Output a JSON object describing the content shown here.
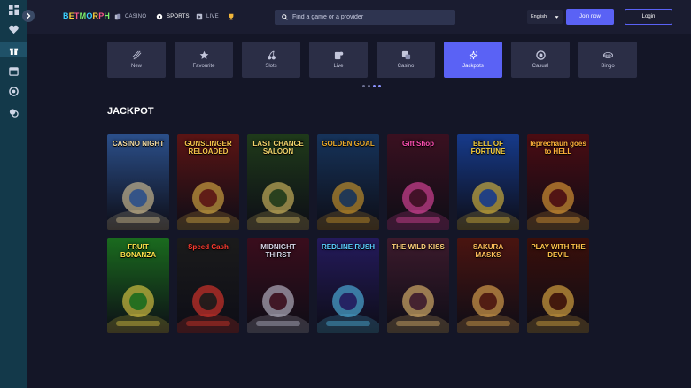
{
  "sidebar": {
    "icons": [
      "grid-icon",
      "heart-icon",
      "gift-icon",
      "calendar-icon",
      "chip-icon",
      "coins-icon"
    ]
  },
  "header": {
    "logo": "BETMORPH",
    "nav": [
      {
        "label": "CASINO",
        "icon": "cards-icon"
      },
      {
        "label": "SPORTS",
        "icon": "ball-icon"
      },
      {
        "label": "LIVE",
        "icon": "live-icon"
      }
    ],
    "search_placeholder": "Find a game or a provider",
    "language": "English",
    "join_label": "Join now",
    "login_label": "Login"
  },
  "categories": [
    {
      "label": "New",
      "icon": "sparkle-icon"
    },
    {
      "label": "Favourite",
      "icon": "star-icon"
    },
    {
      "label": "Slots",
      "icon": "cherry-icon"
    },
    {
      "label": "Live",
      "icon": "dealer-icon"
    },
    {
      "label": "Casino",
      "icon": "dice-icon"
    },
    {
      "label": "Jackpots",
      "icon": "sparkles-icon"
    },
    {
      "label": "Casual",
      "icon": "chip-icon"
    },
    {
      "label": "Bingo",
      "icon": "bingo-icon"
    }
  ],
  "active_category": "Jackpots",
  "section_title": "JACKPOT",
  "games": [
    {
      "title": "CASINO NIGHT",
      "bg": "#2b4f8a",
      "accent": "#f0d9a0"
    },
    {
      "title": "GUNSLINGER RELOADED",
      "bg": "#5a1414",
      "accent": "#f3c34a"
    },
    {
      "title": "LAST CHANCE SALOON",
      "bg": "#1f3a1a",
      "accent": "#f2d36b"
    },
    {
      "title": "GOLDEN GOAL",
      "bg": "#16335a",
      "accent": "#e9a92a"
    },
    {
      "title": "Gift Shop",
      "bg": "#3a1020",
      "accent": "#ff4fb3"
    },
    {
      "title": "BELL OF FORTUNE",
      "bg": "#163a8a",
      "accent": "#f7cf3c"
    },
    {
      "title": "leprechaun goes to HELL",
      "bg": "#4a0c12",
      "accent": "#ffb23a"
    },
    {
      "title": "FRUIT BONANZA",
      "bg": "#1a6b1e",
      "accent": "#ffe14a"
    },
    {
      "title": "Speed Cash",
      "bg": "#1b1b1b",
      "accent": "#ff3b2f"
    },
    {
      "title": "MIDNIGHT THIRST",
      "bg": "#3a0d1c",
      "accent": "#d7d7e8"
    },
    {
      "title": "REDLINE RUSH",
      "bg": "#241a5c",
      "accent": "#5ad0ff"
    },
    {
      "title": "THE WILD KISS",
      "bg": "#3c1a2c",
      "accent": "#ffd27a"
    },
    {
      "title": "SAKURA MASKS",
      "bg": "#4a1410",
      "accent": "#ffbf5a"
    },
    {
      "title": "PLAY WITH THE DEVIL",
      "bg": "#3a0f0a",
      "accent": "#ffc54a"
    }
  ]
}
